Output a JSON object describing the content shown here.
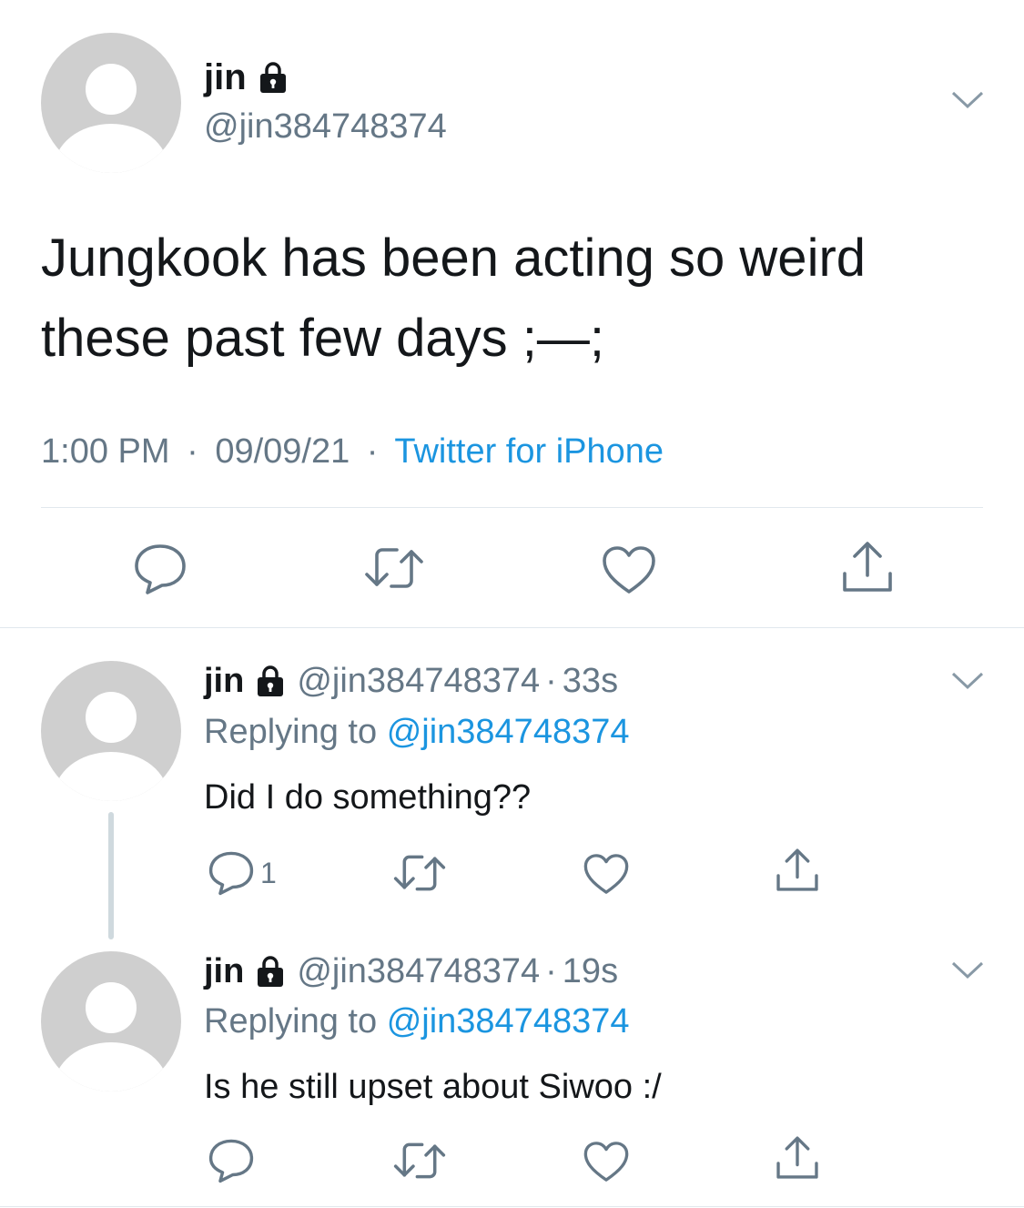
{
  "main_tweet": {
    "display_name": "jin",
    "handle": "@jin384748374",
    "text_line1": "Jungkook has been acting so weird",
    "text_line2": "these past few days ;—;",
    "time": "1:00 PM",
    "date": "09/09/21",
    "separator": "·",
    "source": "Twitter for iPhone"
  },
  "replies": [
    {
      "display_name": "jin",
      "handle": "@jin384748374",
      "separator": "·",
      "age": "33s",
      "replying_label": "Replying to",
      "replying_handle": "@jin384748374",
      "text": "Did I do something??",
      "reply_count": "1"
    },
    {
      "display_name": "jin",
      "handle": "@jin384748374",
      "separator": "·",
      "age": "19s",
      "replying_label": "Replying to",
      "replying_handle": "@jin384748374",
      "text": "Is he still upset about Siwoo :/"
    }
  ],
  "icons": {
    "lock": "lock-icon",
    "chevron": "chevron-down-icon",
    "reply": "reply-icon",
    "retweet": "retweet-icon",
    "like": "heart-icon",
    "share": "share-icon"
  },
  "colors": {
    "text": "#14171a",
    "muted": "#657786",
    "link": "#1b95e0",
    "avatar": "#cfcfcf",
    "divider": "#e1e8ed"
  }
}
